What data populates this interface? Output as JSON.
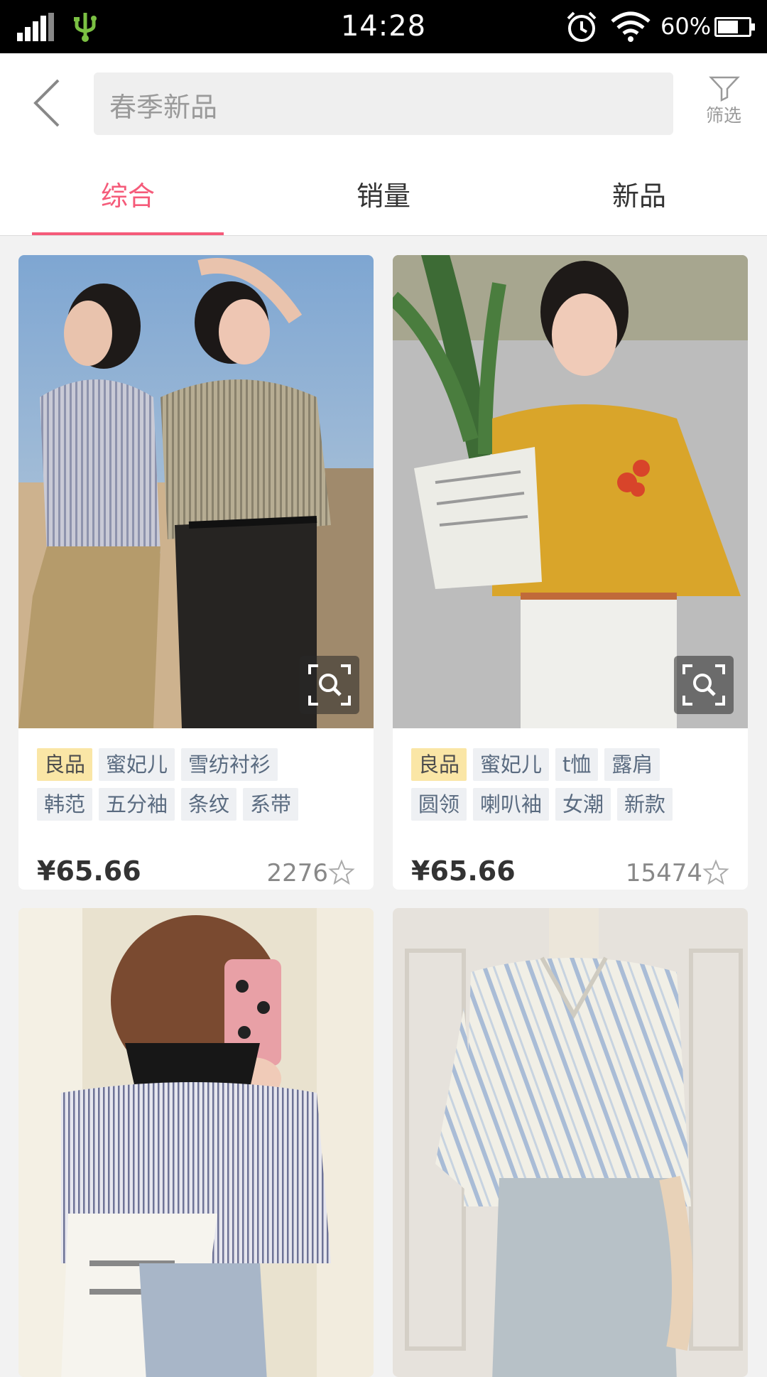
{
  "status_bar": {
    "time": "14:28",
    "battery": "60%",
    "icons": [
      "signal-icon",
      "usb-icon",
      "alarm-icon",
      "wifi-icon",
      "battery-icon"
    ]
  },
  "header": {
    "search_placeholder": "春季新品",
    "filter_label": "筛选",
    "tabs": [
      {
        "label": "综合",
        "active": true
      },
      {
        "label": "销量",
        "active": false
      },
      {
        "label": "新品",
        "active": false
      }
    ]
  },
  "colors": {
    "accent": "#f55b7a",
    "tag_good_bg": "#fae6a6",
    "tag_bg": "#eef0f3",
    "tag_text": "#5a6b80"
  },
  "products": [
    {
      "tags_row1": [
        "良品",
        "蜜妃儿",
        "雪纺衬衫"
      ],
      "tags_row2": [
        "韩范",
        "五分袖",
        "条纹",
        "系带"
      ],
      "price": "¥65.66",
      "sales": "2276"
    },
    {
      "tags_row1": [
        "良品",
        "蜜妃儿",
        "t恤",
        "露肩"
      ],
      "tags_row2": [
        "圆领",
        "喇叭袖",
        "女潮",
        "新款"
      ],
      "price": "¥65.66",
      "sales": "15474"
    },
    {},
    {}
  ]
}
